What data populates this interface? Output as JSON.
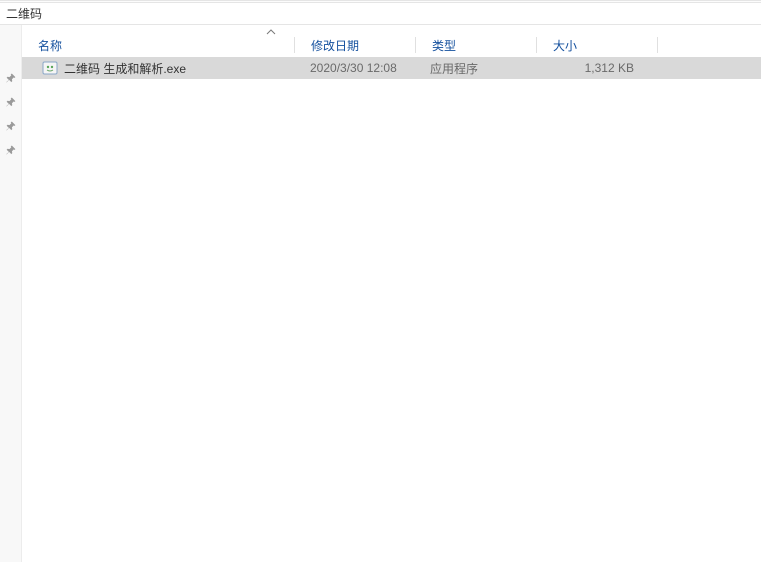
{
  "breadcrumb": {
    "current": "二维码"
  },
  "columns": {
    "name": "名称",
    "date": "修改日期",
    "type": "类型",
    "size": "大小",
    "sorted_by": "name",
    "sort_dir": "asc"
  },
  "files": [
    {
      "name": "二维码 生成和解析.exe",
      "date": "2020/3/30 12:08",
      "type": "应用程序",
      "size": "1,312 KB",
      "selected": true,
      "icon": "exe-icon"
    }
  ],
  "sidebar": {
    "pins": [
      {
        "id": "pin-1"
      },
      {
        "id": "pin-2"
      },
      {
        "id": "pin-3"
      },
      {
        "id": "pin-4"
      }
    ]
  }
}
